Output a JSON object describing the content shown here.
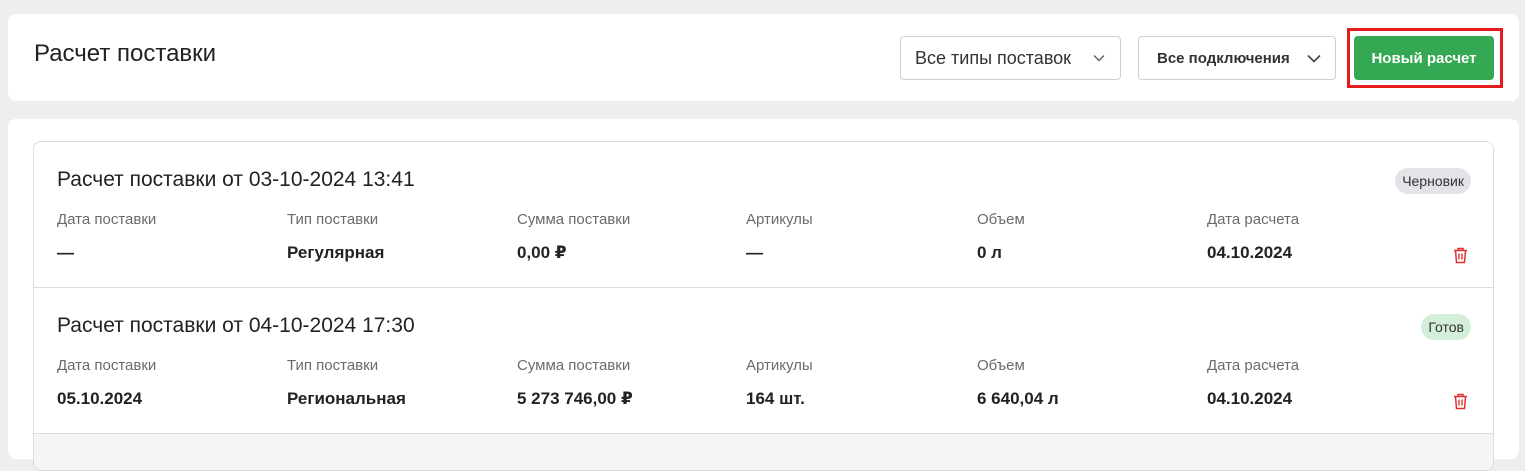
{
  "header": {
    "title": "Расчет поставки",
    "supply_type_filter": {
      "selected": "Все типы поставок",
      "icon": "chevron-down-icon"
    },
    "connection_filter": {
      "selected": "Все подключения",
      "icon": "chevron-down-icon"
    },
    "new_button_label": "Новый расчет"
  },
  "colors": {
    "accent_green": "#34a853",
    "highlight_red": "#e21c1c",
    "delete_icon": "#e03131",
    "badge_draft_bg": "#e3e4e8",
    "badge_ready_bg": "#d3efd9"
  },
  "field_labels": [
    "Дата поставки",
    "Тип поставки",
    "Сумма поставки",
    "Артикулы",
    "Объем",
    "Дата расчета"
  ],
  "calculations": [
    {
      "title": "Расчет поставки от 03-10-2024 13:41",
      "status": "Черновик",
      "delivery_date": "—",
      "supply_type": "Регулярная",
      "supply_sum": "0,00 ₽",
      "articles": "—",
      "volume": "0 л",
      "calc_date": "04.10.2024"
    },
    {
      "title": "Расчет поставки от 04-10-2024 17:30",
      "status": "Готов",
      "delivery_date": "05.10.2024",
      "supply_type": "Региональная",
      "supply_sum": "5 273 746,00 ₽",
      "articles": "164 шт.",
      "volume": "6 640,04 л",
      "calc_date": "04.10.2024"
    }
  ]
}
